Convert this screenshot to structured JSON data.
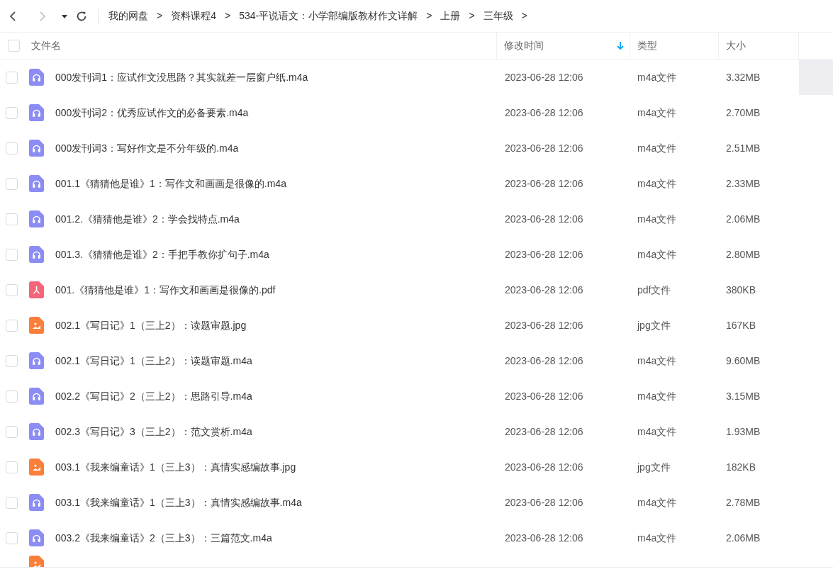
{
  "breadcrumb": {
    "separator": ">",
    "items": [
      "我的网盘",
      "资料课程4",
      "534-平说语文：小学部编版教材作文详解",
      "上册",
      "三年级"
    ]
  },
  "nav": {
    "back_disabled": false,
    "forward_disabled": true
  },
  "table": {
    "columns": [
      {
        "label": "文件名",
        "sorted": false
      },
      {
        "label": "修改时间",
        "sorted": true
      },
      {
        "label": "类型",
        "sorted": false
      },
      {
        "label": "大小",
        "sorted": false
      }
    ],
    "all_checked": false,
    "rows": [
      {
        "kind": "audio",
        "name": "000发刊词1：应试作文没思路？其实就差一层窗户纸.m4a",
        "modified": "2023-06-28 12:06",
        "type": "m4a文件",
        "size": "3.32MB",
        "checked": false,
        "hovered": true
      },
      {
        "kind": "audio",
        "name": "000发刊词2：优秀应试作文的必备要素.m4a",
        "modified": "2023-06-28 12:06",
        "type": "m4a文件",
        "size": "2.70MB",
        "checked": false,
        "hovered": false
      },
      {
        "kind": "audio",
        "name": "000发刊词3：写好作文是不分年级的.m4a",
        "modified": "2023-06-28 12:06",
        "type": "m4a文件",
        "size": "2.51MB",
        "checked": false,
        "hovered": false
      },
      {
        "kind": "audio",
        "name": "001.1《猜猜他是谁》1：写作文和画画是很像的.m4a",
        "modified": "2023-06-28 12:06",
        "type": "m4a文件",
        "size": "2.33MB",
        "checked": false,
        "hovered": false
      },
      {
        "kind": "audio",
        "name": "001.2.《猜猜他是谁》2：学会找特点.m4a",
        "modified": "2023-06-28 12:06",
        "type": "m4a文件",
        "size": "2.06MB",
        "checked": false,
        "hovered": false
      },
      {
        "kind": "audio",
        "name": "001.3.《猜猜他是谁》2：手把手教你扩句子.m4a",
        "modified": "2023-06-28 12:06",
        "type": "m4a文件",
        "size": "2.80MB",
        "checked": false,
        "hovered": false
      },
      {
        "kind": "pdf",
        "name": "001.《猜猜他是谁》1：写作文和画画是很像的.pdf",
        "modified": "2023-06-28 12:06",
        "type": "pdf文件",
        "size": "380KB",
        "checked": false,
        "hovered": false
      },
      {
        "kind": "image",
        "name": "002.1《写日记》1（三上2）：读题审题.jpg",
        "modified": "2023-06-28 12:06",
        "type": "jpg文件",
        "size": "167KB",
        "checked": false,
        "hovered": false
      },
      {
        "kind": "audio",
        "name": "002.1《写日记》1（三上2）：读题审题.m4a",
        "modified": "2023-06-28 12:06",
        "type": "m4a文件",
        "size": "9.60MB",
        "checked": false,
        "hovered": false
      },
      {
        "kind": "audio",
        "name": "002.2《写日记》2（三上2）：思路引导.m4a",
        "modified": "2023-06-28 12:06",
        "type": "m4a文件",
        "size": "3.15MB",
        "checked": false,
        "hovered": false
      },
      {
        "kind": "audio",
        "name": "002.3《写日记》3（三上2）：范文赏析.m4a",
        "modified": "2023-06-28 12:06",
        "type": "m4a文件",
        "size": "1.93MB",
        "checked": false,
        "hovered": false
      },
      {
        "kind": "image",
        "name": "003.1《我来编童话》1（三上3）：真情实感编故事.jpg",
        "modified": "2023-06-28 12:06",
        "type": "jpg文件",
        "size": "182KB",
        "checked": false,
        "hovered": false
      },
      {
        "kind": "audio",
        "name": "003.1《我来编童话》1（三上3）：真情实感编故事.m4a",
        "modified": "2023-06-28 12:06",
        "type": "m4a文件",
        "size": "2.78MB",
        "checked": false,
        "hovered": false
      },
      {
        "kind": "audio",
        "name": "003.2《我来编童话》2（三上3）：三篇范文.m4a",
        "modified": "2023-06-28 12:06",
        "type": "m4a文件",
        "size": "2.06MB",
        "checked": false,
        "hovered": false
      }
    ],
    "cut_off_row": {
      "kind": "image"
    }
  }
}
